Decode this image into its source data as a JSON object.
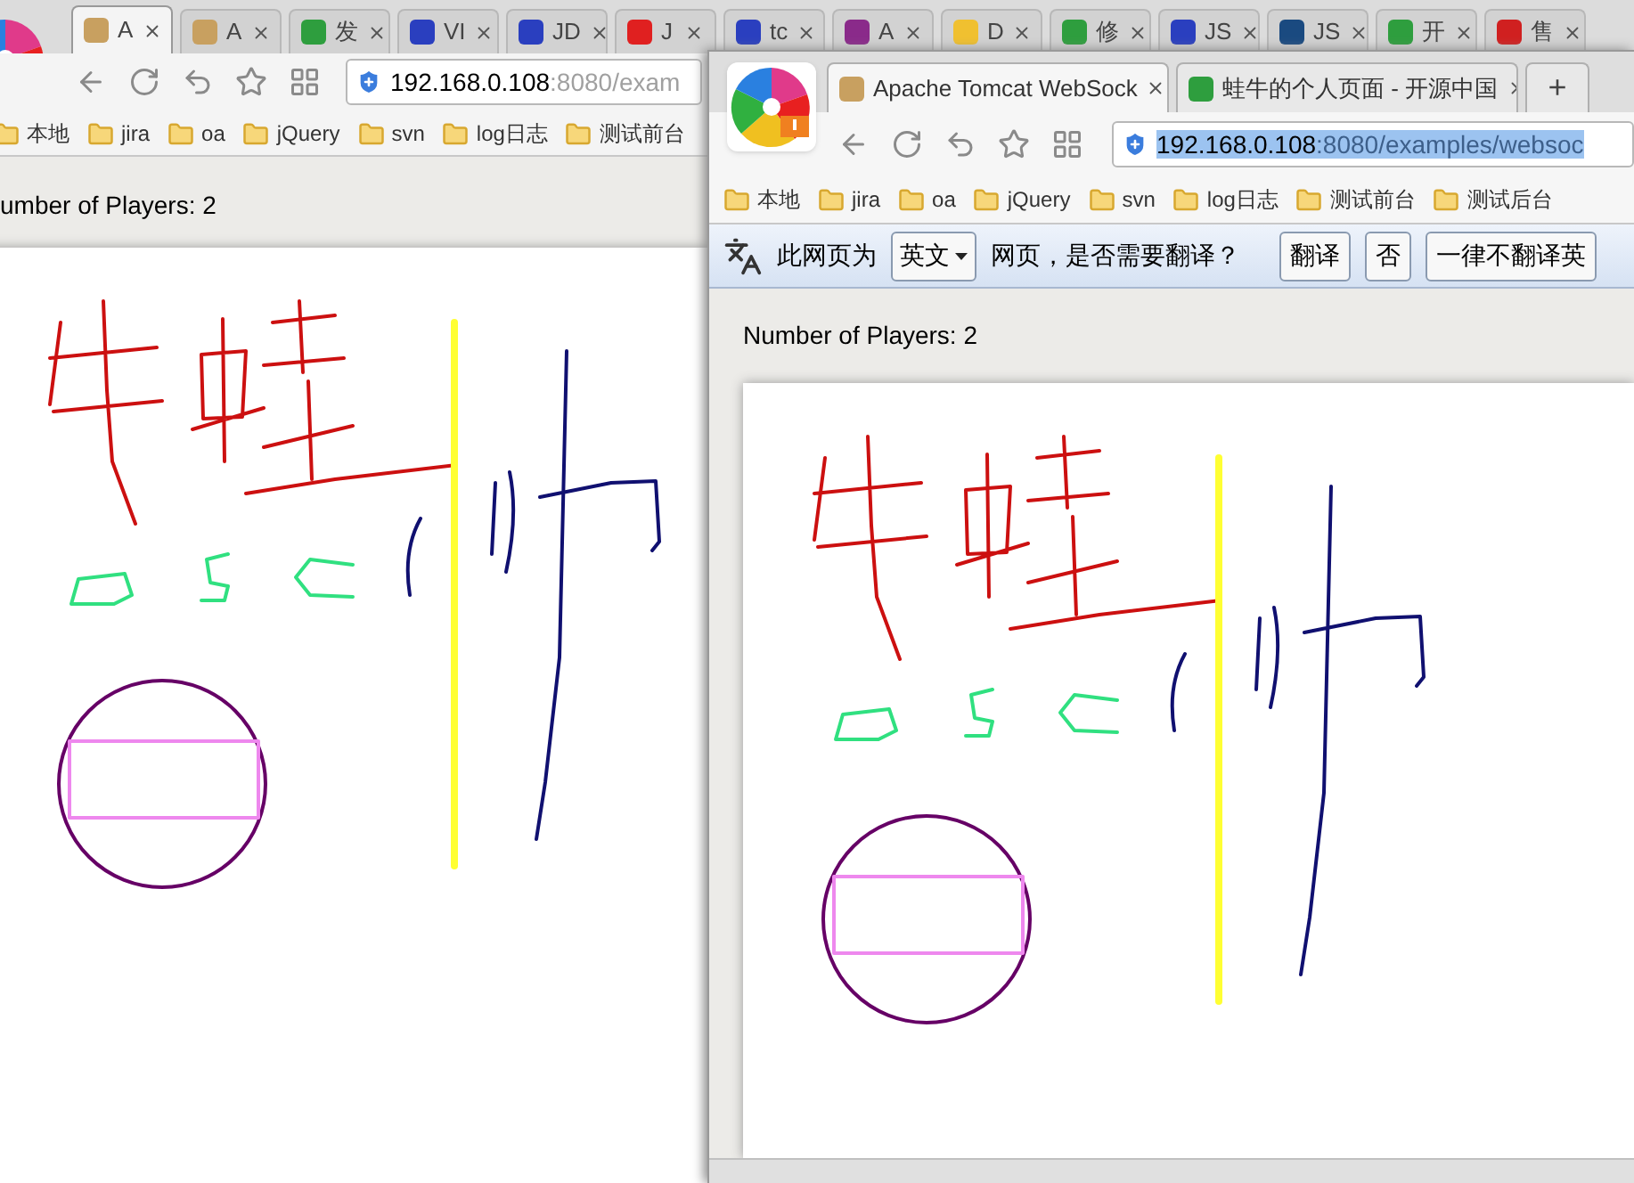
{
  "back_window": {
    "tabs": [
      {
        "label": "A",
        "selected": true,
        "color": "#c8a060"
      },
      {
        "label": "A",
        "selected": false,
        "color": "#c8a060"
      },
      {
        "label": "发",
        "selected": false,
        "color": "#2e9e3e"
      },
      {
        "label": "VI",
        "selected": false,
        "color": "#2a3fbf"
      },
      {
        "label": "JD",
        "selected": false,
        "color": "#2a3fbf"
      },
      {
        "label": "J",
        "selected": false,
        "color": "#e02020"
      },
      {
        "label": "tc",
        "selected": false,
        "color": "#2a3fbf"
      },
      {
        "label": "A",
        "selected": false,
        "color": "#8a2a8a"
      },
      {
        "label": "D",
        "selected": false,
        "color": "#f0c030"
      },
      {
        "label": "修",
        "selected": false,
        "color": "#2e9e3e"
      },
      {
        "label": "JS",
        "selected": false,
        "color": "#2a3fbf"
      },
      {
        "label": "JS",
        "selected": false,
        "color": "#1a4a80"
      },
      {
        "label": "开",
        "selected": false,
        "color": "#2e9e3e"
      },
      {
        "label": "售",
        "selected": false,
        "color": "#d02020"
      }
    ],
    "address_bar": {
      "host": "192.168.0.108",
      "path": ":8080/exam",
      "selected": false
    },
    "bookmarks": [
      "本地",
      "jira",
      "oa",
      "jQuery",
      "svn",
      "log日志",
      "测试前台"
    ],
    "players": "umber of Players: 2"
  },
  "front_window": {
    "tabs": [
      {
        "label": "Apache Tomcat WebSock",
        "selected": true,
        "color": "#c8a060"
      },
      {
        "label": "蛙牛的个人页面 - 开源中国",
        "selected": false,
        "color": "#2e9e3e"
      }
    ],
    "new_tab": "+",
    "address_bar": {
      "host": "192.168.0.108",
      "path": ":8080/examples/websoc",
      "selected": true
    },
    "bookmarks": [
      "本地",
      "jira",
      "oa",
      "jQuery",
      "svn",
      "log日志",
      "测试前台",
      "测试后台"
    ],
    "translate_bar": {
      "prefix": "此网页为",
      "language": "英文",
      "question": "网页，是否需要翻译？",
      "buttons": [
        "翻译",
        "否",
        "一律不翻译英"
      ]
    },
    "players": "Number of Players: 2"
  }
}
